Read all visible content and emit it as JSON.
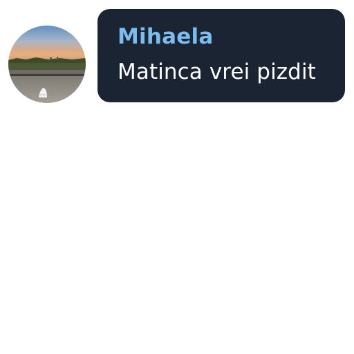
{
  "message": {
    "sender": "Mihaela",
    "text": "Matinca vrei pizdit"
  },
  "avatar": {
    "icon": "profile-photo-sunset-landscape"
  },
  "colors": {
    "bubble_background": "#1a2433",
    "sender_name": "#7cbcee",
    "message_text": "#ffffff",
    "page_background": "#ffffff"
  }
}
